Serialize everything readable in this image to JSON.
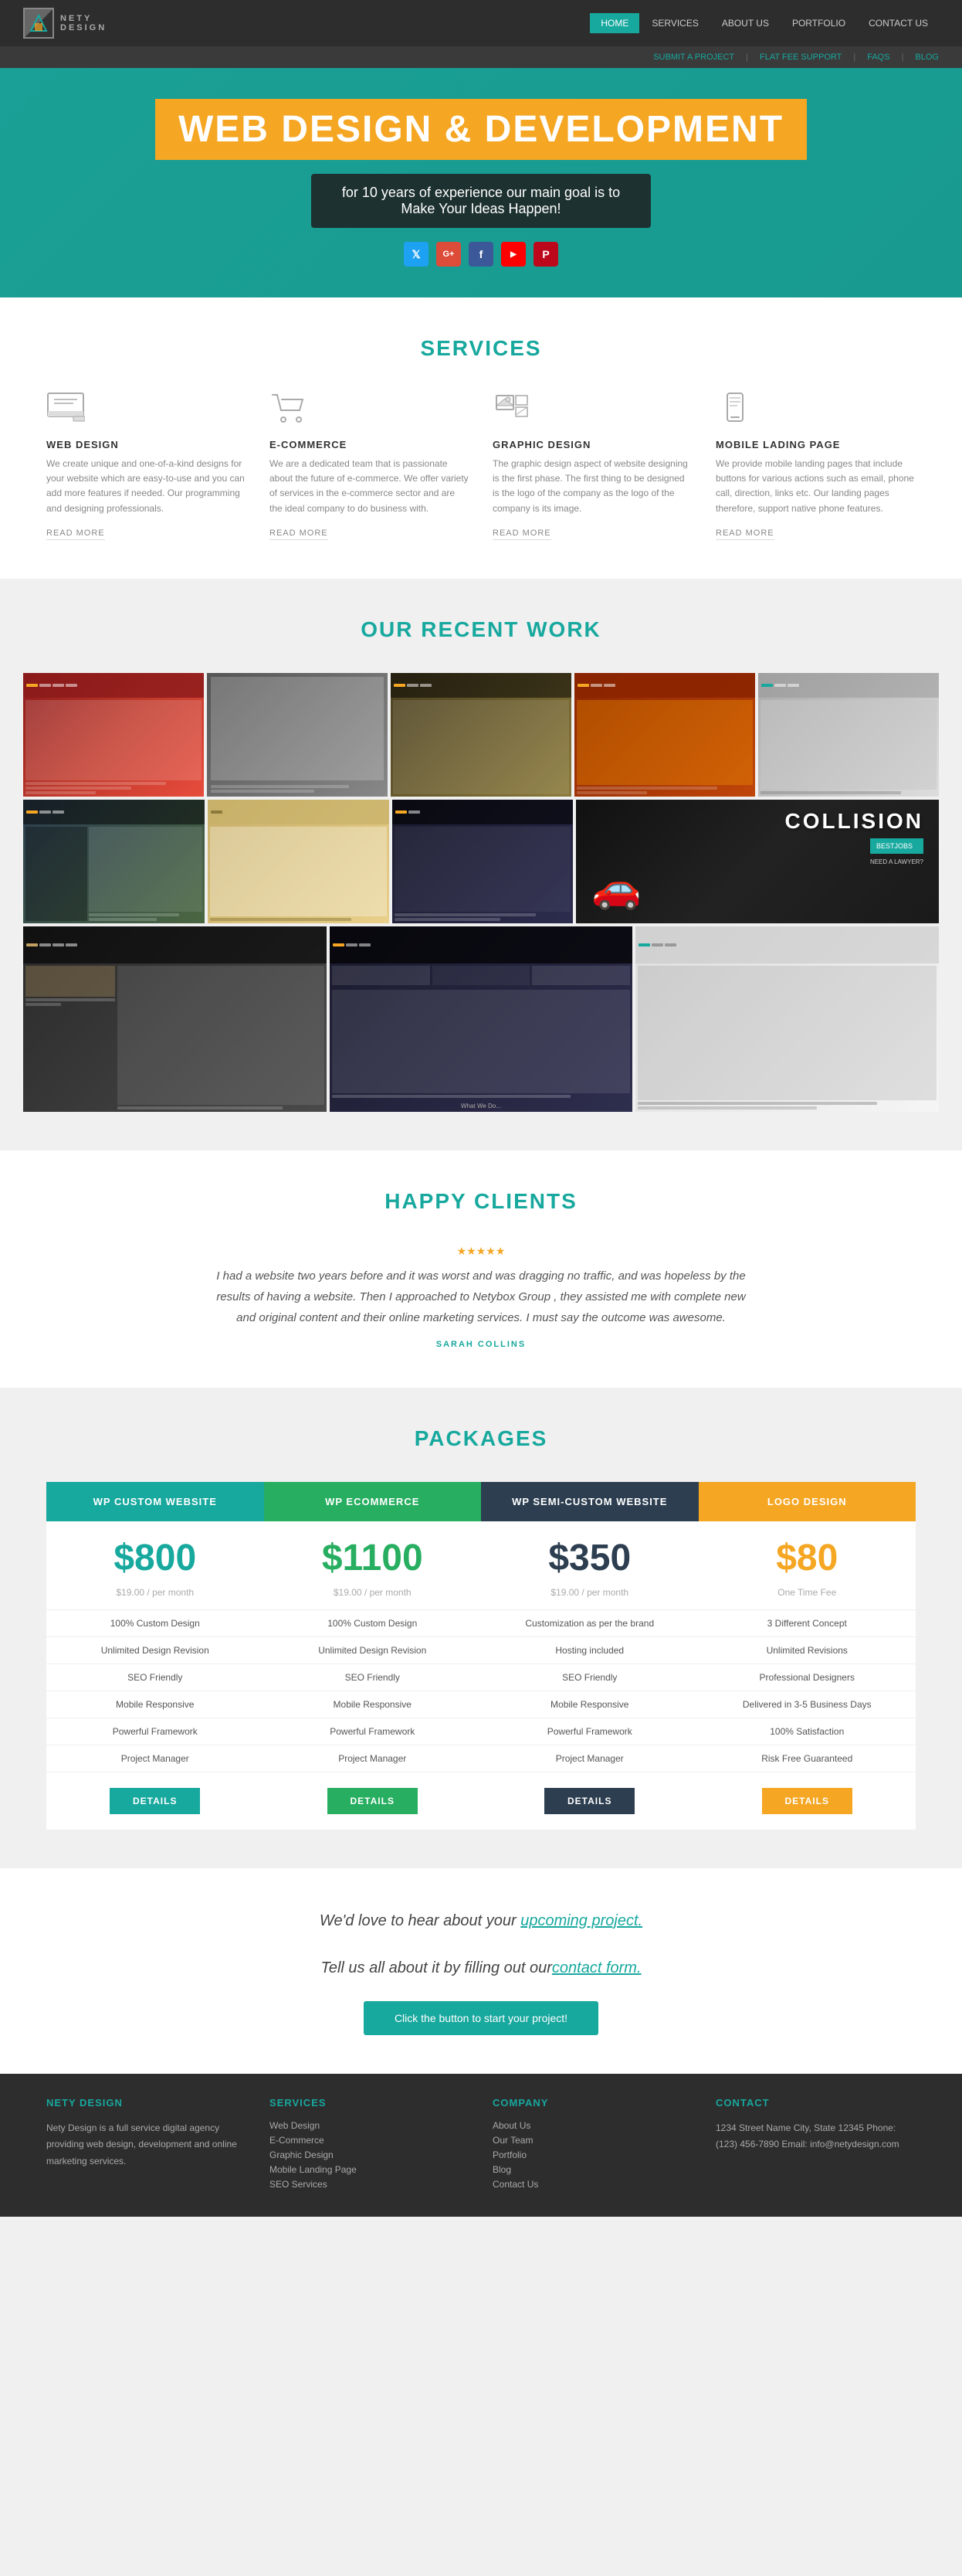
{
  "header": {
    "logo_line1": "NETY",
    "logo_line2": "DESIGN",
    "nav_items": [
      {
        "label": "HOME",
        "active": true
      },
      {
        "label": "SERVICES",
        "active": false
      },
      {
        "label": "ABOUT US",
        "active": false
      },
      {
        "label": "PORTFOLIO",
        "active": false
      },
      {
        "label": "CONTACT US",
        "active": false
      }
    ]
  },
  "topbar": {
    "links": [
      {
        "label": "SUBMIT A PROJECT"
      },
      {
        "label": "FLAT FEE SUPPORT"
      },
      {
        "label": "FAQS"
      },
      {
        "label": "BLOG"
      }
    ]
  },
  "hero": {
    "title": "WEB DESIGN & DEVELOPMENT",
    "subtitle_line1": "for 10 years of experience our main goal is to",
    "subtitle_line2": "Make Your Ideas Happen!",
    "social_icons": [
      "twitter",
      "google-plus",
      "facebook",
      "youtube",
      "pinterest"
    ]
  },
  "services": {
    "section_title": "SERVICES",
    "items": [
      {
        "name": "WEB DESIGN",
        "description": "We create unique and one-of-a-kind designs for your website which are easy-to-use and you can add more features if needed. Our programming and designing professionals.",
        "read_more": "READ MORE"
      },
      {
        "name": "E-COMMERCE",
        "description": "We are a dedicated team that is passionate about the future of e-commerce. We offer variety of services in the e-commerce sector and are the ideal company to do business with.",
        "read_more": "READ MORE"
      },
      {
        "name": "GRAPHIC DESIGN",
        "description": "The graphic design aspect of website designing is the first phase. The first thing to be designed is the logo of the company as the logo of the company is its image.",
        "read_more": "READ MORE"
      },
      {
        "name": "MOBILE LADING PAGE",
        "description": "We provide mobile landing pages that include buttons for various actions such as email, phone call, direction, links etc. Our landing pages therefore, support native phone features.",
        "read_more": "READ MORE"
      }
    ]
  },
  "portfolio": {
    "section_title": "OUR RECENT WORK"
  },
  "clients": {
    "section_title": "HAPPY CLIENTS",
    "testimonial": "I had a website two years before and it was worst and was dragging no traffic, and was hopeless by the results of having a website. Then I approached to Netybox Group , they assisted me with complete new and original content and their online marketing services. I must say the outcome was awesome.",
    "author": "SARAH COLLINS"
  },
  "packages": {
    "section_title": "PACKAGES",
    "items": [
      {
        "title": "WP CUSTOM WEBSITE",
        "price": "$800",
        "period": "$19.00 / per month",
        "color": "blue",
        "features": [
          "100% Custom Design",
          "Unlimited Design Revision",
          "SEO Friendly",
          "Mobile Responsive",
          "Powerful Framework",
          "Project Manager"
        ],
        "button": "DETAILS"
      },
      {
        "title": "WP ECOMMERCE",
        "price": "$1100",
        "period": "$19.00 / per month",
        "color": "green",
        "features": [
          "100% Custom Design",
          "Unlimited Design Revision",
          "SEO Friendly",
          "Mobile Responsive",
          "Powerful Framework",
          "Project Manager"
        ],
        "button": "DETAILS"
      },
      {
        "title": "WP SEMI-CUSTOM WEBSITE",
        "price": "$350",
        "period": "$19.00 / per month",
        "color": "dark",
        "features": [
          "Customization as per the brand",
          "Hosting included",
          "SEO Friendly",
          "Mobile Responsive",
          "Powerful Framework",
          "Project Manager"
        ],
        "button": "DETAILS"
      },
      {
        "title": "LOGO DESIGN",
        "price": "$80",
        "period": "One Time Fee",
        "color": "orange",
        "features": [
          "3 Different Concept",
          "Unlimited Revisions",
          "Professional Designers",
          "Delivered in 3-5 Business Days",
          "100% Satisfaction",
          "Risk Free Guaranteed"
        ],
        "button": "DETAILS"
      }
    ]
  },
  "cta": {
    "line1_prefix": "We'd love to hear about your ",
    "line1_link": "upcoming project.",
    "line2_prefix": "Tell us all about it by filling out our",
    "line2_link": "contact form.",
    "button": "Click the button to start your project!"
  },
  "footer": {
    "cols": [
      {
        "title": "NETY DESIGN",
        "content": "Nety Design is a full service digital agency providing web design, development and online marketing services."
      },
      {
        "title": "SERVICES",
        "links": [
          "Web Design",
          "E-Commerce",
          "Graphic Design",
          "Mobile Landing Page",
          "SEO Services"
        ]
      },
      {
        "title": "COMPANY",
        "links": [
          "About Us",
          "Our Team",
          "Portfolio",
          "Blog",
          "Contact Us"
        ]
      },
      {
        "title": "CONTACT",
        "content": "1234 Street Name\nCity, State 12345\nPhone: (123) 456-7890\nEmail: info@netydesign.com"
      }
    ]
  }
}
